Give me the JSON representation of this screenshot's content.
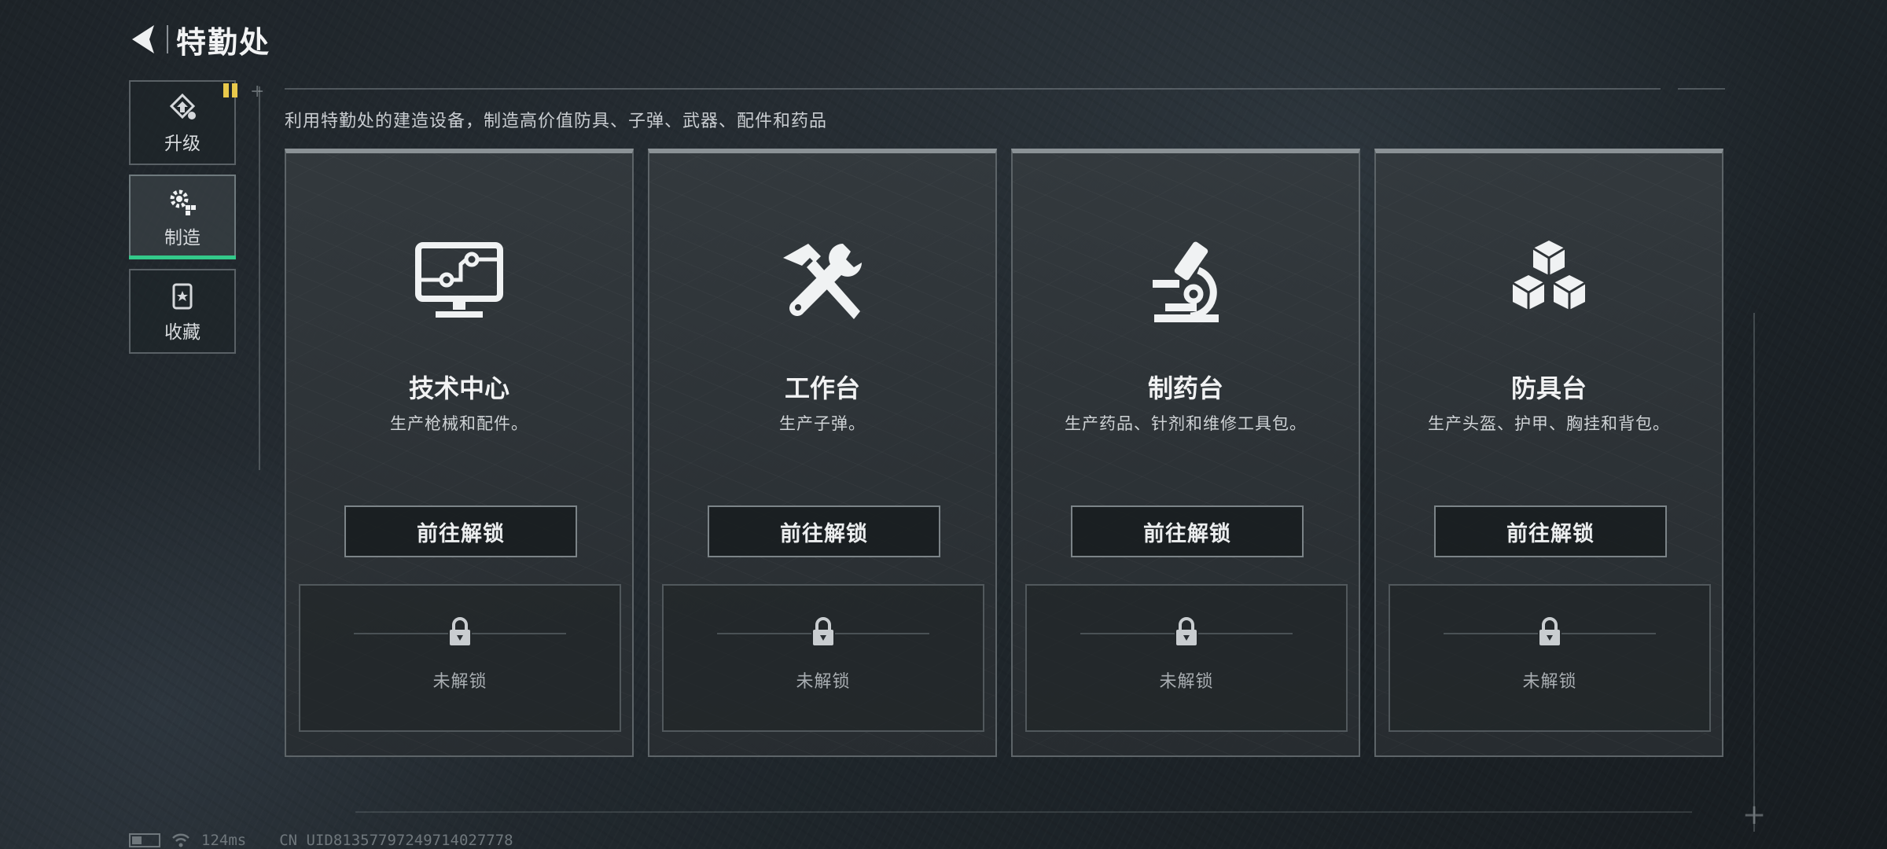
{
  "header": {
    "title": "特勤处"
  },
  "sidebar": {
    "items": [
      {
        "label": "升级",
        "icon": "upgrade-icon",
        "active": false
      },
      {
        "label": "制造",
        "icon": "manufacture-gear-icon",
        "active": true
      },
      {
        "label": "收藏",
        "icon": "collection-icon",
        "active": false
      }
    ]
  },
  "description": "利用特勤处的建造设备，制造高价值防具、子弹、武器、配件和药品",
  "cards": [
    {
      "title": "技术中心",
      "subtitle": "生产枪械和配件。",
      "icon": "monitor-circuit-icon",
      "button": "前往解锁",
      "lock_text": "未解锁"
    },
    {
      "title": "工作台",
      "subtitle": "生产子弹。",
      "icon": "hammer-wrench-icon",
      "button": "前往解锁",
      "lock_text": "未解锁"
    },
    {
      "title": "制药台",
      "subtitle": "生产药品、针剂和维修工具包。",
      "icon": "microscope-icon",
      "button": "前往解锁",
      "lock_text": "未解锁"
    },
    {
      "title": "防具台",
      "subtitle": "生产头盔、护甲、胸挂和背包。",
      "icon": "boxes-icon",
      "button": "前往解锁",
      "lock_text": "未解锁"
    }
  ],
  "status": {
    "ping": "124ms",
    "uid": "CN UID81357797249714027778"
  },
  "colors": {
    "accent": "#33c98a",
    "badge": "#e9c94b"
  }
}
